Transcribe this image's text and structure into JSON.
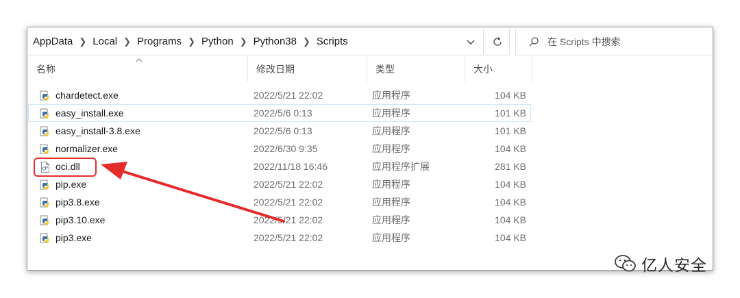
{
  "breadcrumbs": [
    "AppData",
    "Local",
    "Programs",
    "Python",
    "Python38",
    "Scripts"
  ],
  "search": {
    "placeholder": "在 Scripts 中搜索"
  },
  "columns": {
    "name": "名称",
    "date": "修改日期",
    "type": "类型",
    "size": "大小"
  },
  "files": [
    {
      "name": "chardetect.exe",
      "date": "2022/5/21 22:02",
      "type": "应用程序",
      "size": "104 KB",
      "icon": "python-exe-icon"
    },
    {
      "name": "easy_install.exe",
      "date": "2022/5/6 0:13",
      "type": "应用程序",
      "size": "101 KB",
      "icon": "python-exe-icon"
    },
    {
      "name": "easy_install-3.8.exe",
      "date": "2022/5/6 0:13",
      "type": "应用程序",
      "size": "101 KB",
      "icon": "python-exe-icon"
    },
    {
      "name": "normalizer.exe",
      "date": "2022/6/30 9:35",
      "type": "应用程序",
      "size": "104 KB",
      "icon": "python-exe-icon"
    },
    {
      "name": "oci.dll",
      "date": "2022/11/18 16:46",
      "type": "应用程序扩展",
      "size": "281 KB",
      "icon": "dll-file-icon"
    },
    {
      "name": "pip.exe",
      "date": "2022/5/21 22:02",
      "type": "应用程序",
      "size": "104 KB",
      "icon": "python-exe-icon"
    },
    {
      "name": "pip3.8.exe",
      "date": "2022/5/21 22:02",
      "type": "应用程序",
      "size": "104 KB",
      "icon": "python-exe-icon"
    },
    {
      "name": "pip3.10.exe",
      "date": "2022/5/21 22:02",
      "type": "应用程序",
      "size": "104 KB",
      "icon": "python-exe-icon"
    },
    {
      "name": "pip3.exe",
      "date": "2022/5/21 22:02",
      "type": "应用程序",
      "size": "104 KB",
      "icon": "python-exe-icon"
    }
  ],
  "annotation": {
    "highlight_color": "#e52b2b",
    "target": "oci.dll"
  },
  "watermark": {
    "text": "亿人安全"
  },
  "colors": {
    "hover_border": "#cde8ff",
    "window_border": "#9a9a9a"
  }
}
